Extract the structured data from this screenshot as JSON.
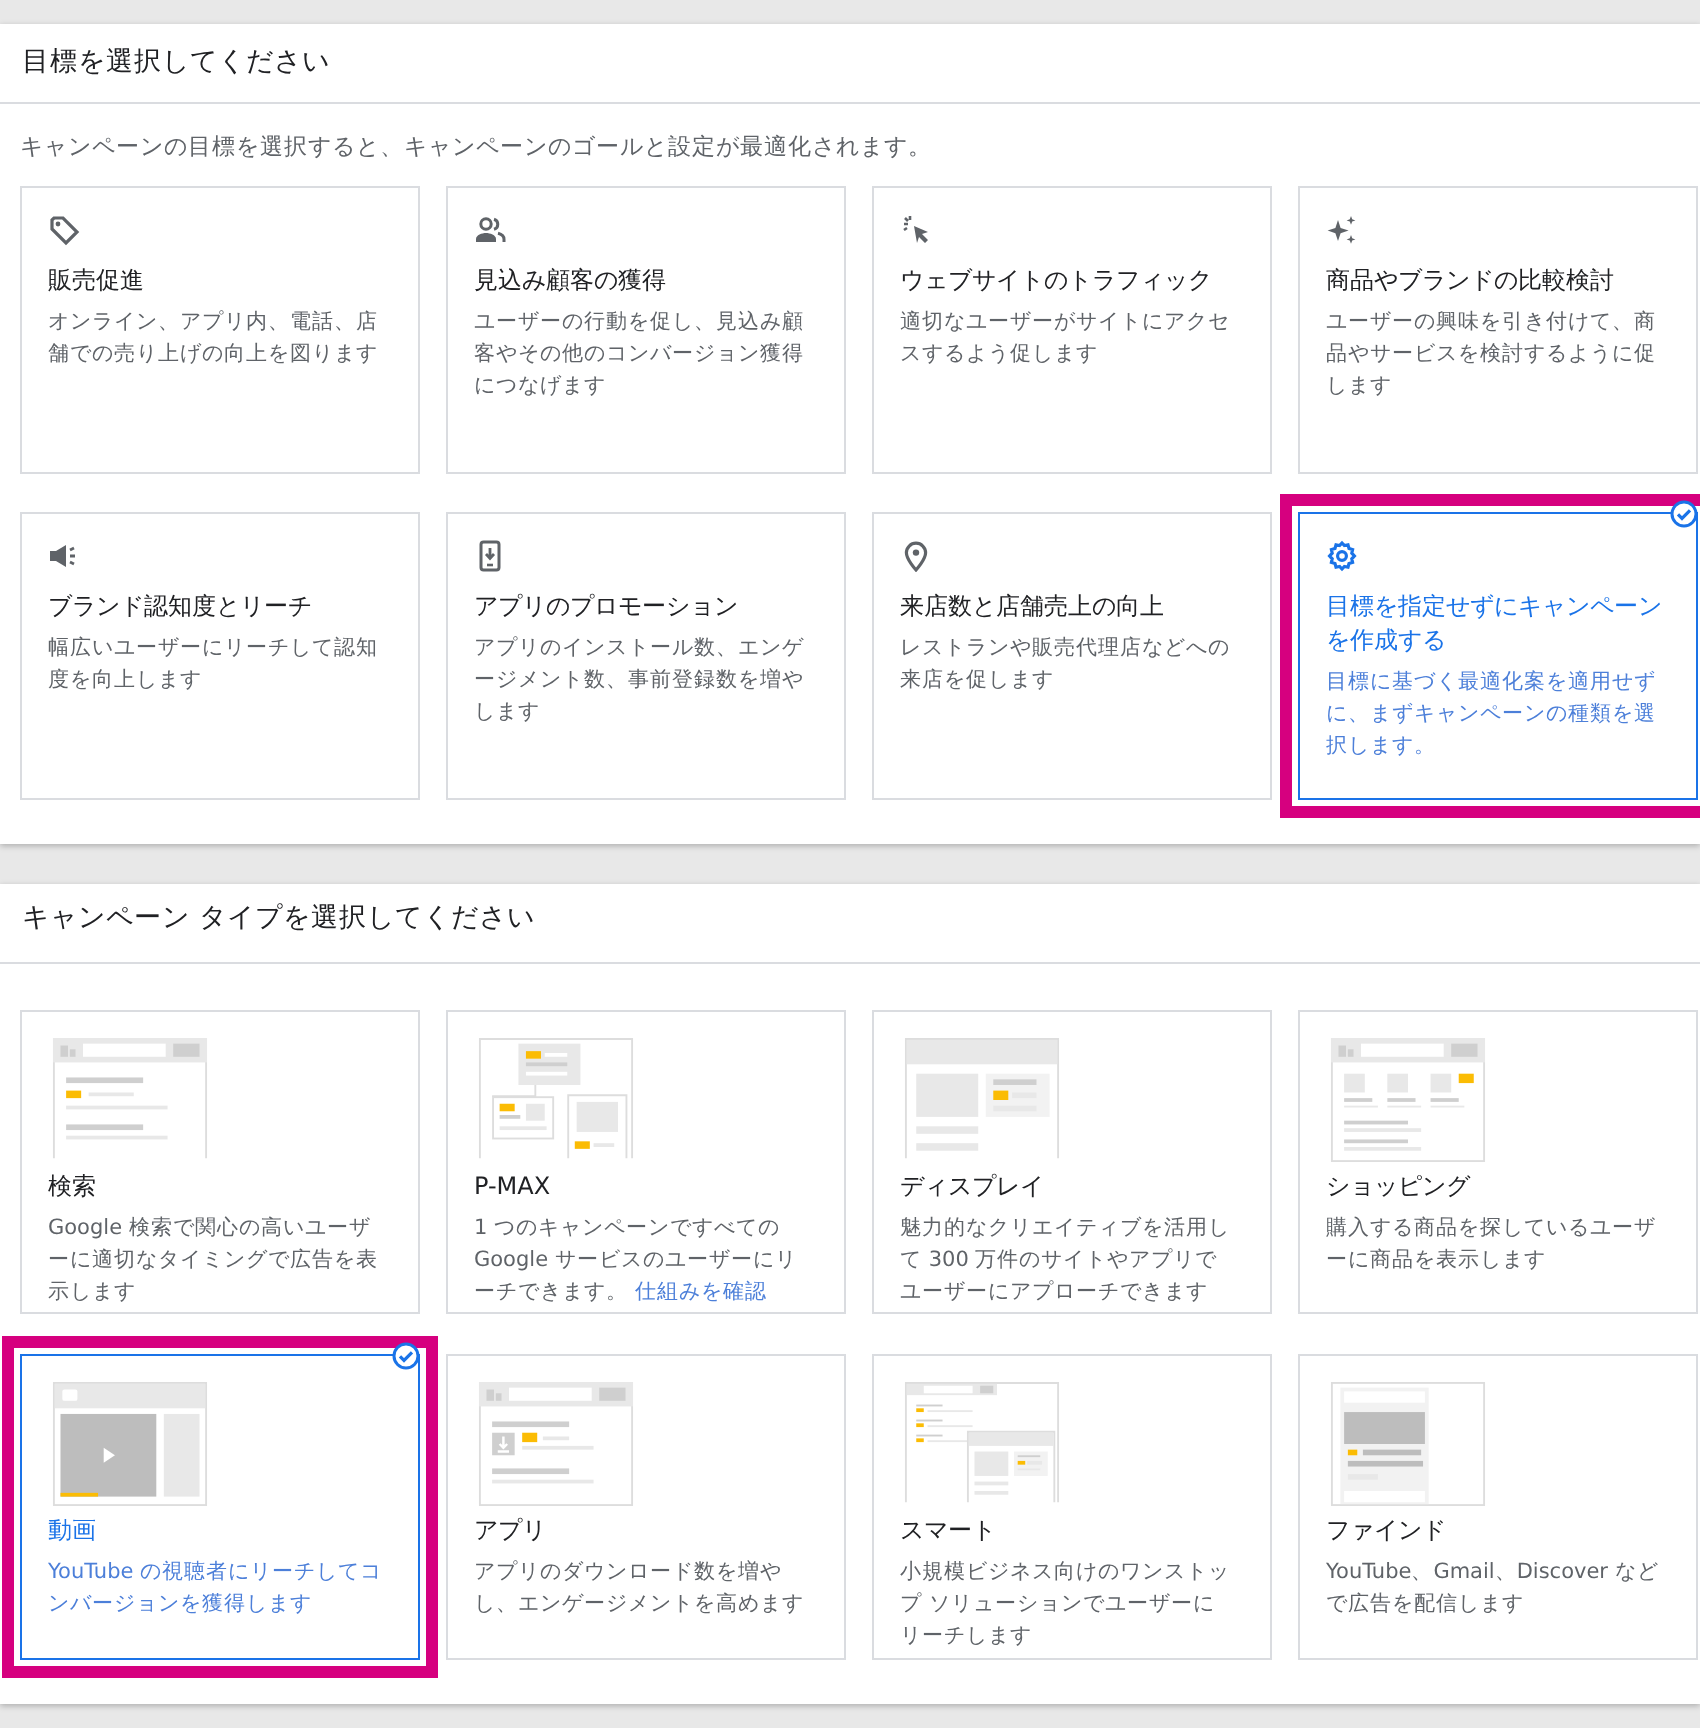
{
  "goal_section": {
    "title": "目標を選択してください",
    "description": "キャンペーンの目標を選択すると、キャンペーンのゴールと設定が最適化されます。",
    "cards": [
      {
        "kind": "tag",
        "title": "販売促進",
        "description": "オンライン、アプリ内、電話、店舗での売り上げの向上を図ります",
        "selected": false
      },
      {
        "kind": "people",
        "title": "見込み顧客の獲得",
        "description": "ユーザーの行動を促し、見込み顧客やその他のコンバージョン獲得につなげます",
        "selected": false
      },
      {
        "kind": "click",
        "title": "ウェブサイトのトラフィック",
        "description": "適切なユーザーがサイトにアクセスするよう促します",
        "selected": false
      },
      {
        "kind": "sparkle",
        "title": "商品やブランドの比較検討",
        "description": "ユーザーの興味を引き付けて、商品やサービスを検討するように促します",
        "selected": false
      },
      {
        "kind": "megaphone",
        "title": "ブランド認知度とリーチ",
        "description": "幅広いユーザーにリーチして認知度を向上します",
        "selected": false
      },
      {
        "kind": "phone",
        "title": "アプリのプロモーション",
        "description": "アプリのインストール数、エンゲージメント数、事前登録数を増やします",
        "selected": false
      },
      {
        "kind": "pin",
        "title": "来店数と店舗売上の向上",
        "description": "レストランや販売代理店などへの来店を促します",
        "selected": false
      },
      {
        "kind": "gear",
        "title": "目標を指定せずにキャンペーンを作成する",
        "description": "目標に基づく最適化案を適用せずに、まずキャンペーンの種類を選択します。",
        "selected": true
      }
    ]
  },
  "campaign_type_section": {
    "title": "キャンペーン タイプを選択してください",
    "cards": [
      {
        "kind": "search",
        "title": "検索",
        "description": "Google 検索で関心の高いユーザーに適切なタイミングで広告を表示します",
        "selected": false
      },
      {
        "kind": "pmax",
        "title": "P-MAX",
        "description": "1 つのキャンペーンですべての Google サービスのユーザーにリーチできます。",
        "link": "仕組みを確認",
        "selected": false
      },
      {
        "kind": "display",
        "title": "ディスプレイ",
        "description": "魅力的なクリエイティブを活用して 300 万件のサイトやアプリでユーザーにアプローチできます",
        "selected": false
      },
      {
        "kind": "shopping",
        "title": "ショッピング",
        "description": "購入する商品を探しているユーザーに商品を表示します",
        "selected": false
      },
      {
        "kind": "video",
        "title": "動画",
        "description": "YouTube の視聴者にリーチしてコンバージョンを獲得します",
        "selected": true
      },
      {
        "kind": "app",
        "title": "アプリ",
        "description": "アプリのダウンロード数を増やし、エンゲージメントを高めます",
        "selected": false
      },
      {
        "kind": "smart",
        "title": "スマート",
        "description": "小規模ビジネス向けのワンストップ ソリューションでユーザーにリーチします",
        "selected": false
      },
      {
        "kind": "discover",
        "title": "ファインド",
        "description": "YouTube、Gmail、Discover などで広告を配信します",
        "selected": false
      }
    ]
  }
}
